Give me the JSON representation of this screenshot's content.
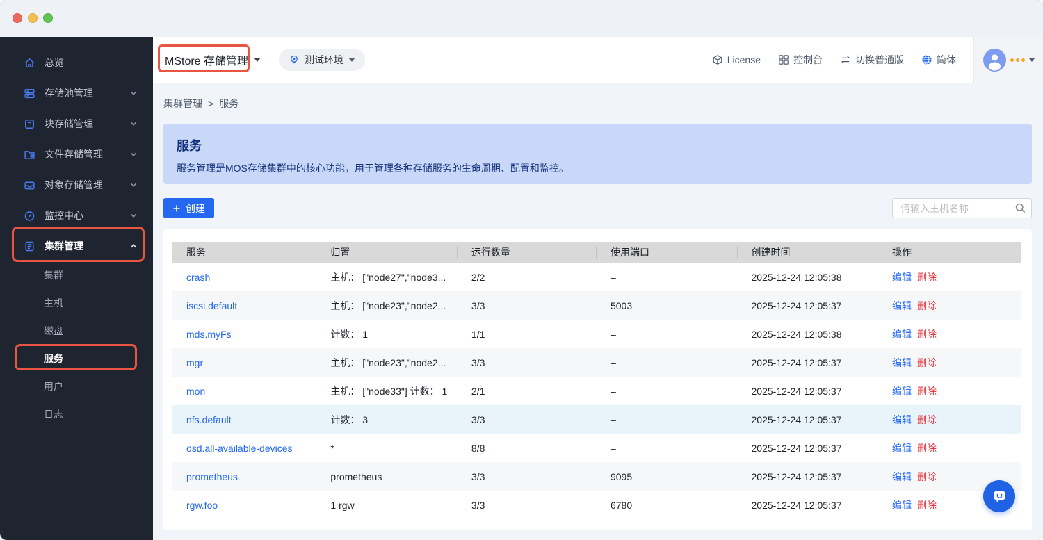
{
  "colors": {
    "accent_blue": "#2468f2",
    "annotation_red": "#e85642",
    "delete_red": "#e5353e",
    "sidebar_bg": "#1e2430",
    "banner_bg": "#c9d7f8",
    "table_header_bg": "#d9d9d9",
    "highlight_row_bg": "#e8f3fa"
  },
  "topbar": {
    "app_title": "MStore 存储管理",
    "env_label": "测试环境",
    "links": [
      {
        "label": "License",
        "icon": "license-cube-icon"
      },
      {
        "label": "控制台",
        "icon": "console-grid-icon"
      },
      {
        "label": "切换普通版",
        "icon": "switch-arrows-icon"
      },
      {
        "label": "简体",
        "icon": "globe-icon"
      }
    ]
  },
  "sidebar": {
    "items": [
      {
        "label": "总览",
        "icon": "home-icon"
      },
      {
        "label": "存储池管理",
        "icon": "storage-pool-icon",
        "chevron": "down"
      },
      {
        "label": "块存储管理",
        "icon": "block-storage-icon",
        "chevron": "down"
      },
      {
        "label": "文件存储管理",
        "icon": "file-storage-icon",
        "chevron": "down"
      },
      {
        "label": "对象存储管理",
        "icon": "object-storage-icon",
        "chevron": "down"
      },
      {
        "label": "监控中心",
        "icon": "monitor-icon",
        "chevron": "down"
      },
      {
        "label": "集群管理",
        "icon": "cluster-icon",
        "chevron": "up",
        "active": true
      }
    ],
    "cluster_children": [
      "集群",
      "主机",
      "磁盘",
      "服务",
      "用户",
      "日志"
    ],
    "active_child": "服务"
  },
  "breadcrumb": {
    "items": [
      "集群管理",
      "服务"
    ],
    "separator": ">"
  },
  "banner": {
    "title": "服务",
    "description": "服务管理是MOS存储集群中的核心功能，用于管理各种存储服务的生命周期、配置和监控。"
  },
  "toolbar": {
    "create_label": "创建",
    "search_placeholder": "请输入主机名称"
  },
  "table": {
    "columns": [
      "服务",
      "归置",
      "运行数量",
      "使用端口",
      "创建时间",
      "操作"
    ],
    "actions": {
      "edit": "编辑",
      "delete": "删除"
    },
    "rows": [
      {
        "service": "crash",
        "placement": "主机： [\"node27\",\"node3...",
        "running": "2/2",
        "ports": "–",
        "created": "2025-12-24 12:05:38"
      },
      {
        "service": "iscsi.default",
        "placement": "主机： [\"node23\",\"node2...",
        "running": "3/3",
        "ports": "5003",
        "created": "2025-12-24 12:05:37"
      },
      {
        "service": "mds.myFs",
        "placement": "计数： 1",
        "running": "1/1",
        "ports": "–",
        "created": "2025-12-24 12:05:38"
      },
      {
        "service": "mgr",
        "placement": "主机： [\"node23\",\"node2...",
        "running": "3/3",
        "ports": "–",
        "created": "2025-12-24 12:05:37"
      },
      {
        "service": "mon",
        "placement": "主机： [\"node33\"] 计数： 1",
        "running": "2/1",
        "ports": "–",
        "created": "2025-12-24 12:05:37"
      },
      {
        "service": "nfs.default",
        "placement": "计数： 3",
        "running": "3/3",
        "ports": "–",
        "created": "2025-12-24 12:05:37",
        "highlighted": true
      },
      {
        "service": "osd.all-available-devices",
        "placement": "*",
        "running": "8/8",
        "ports": "–",
        "created": "2025-12-24 12:05:37"
      },
      {
        "service": "prometheus",
        "placement": "prometheus",
        "running": "3/3",
        "ports": "9095",
        "created": "2025-12-24 12:05:37"
      },
      {
        "service": "rgw.foo",
        "placement": "1 rgw",
        "running": "3/3",
        "ports": "6780",
        "created": "2025-12-24 12:05:37"
      }
    ]
  }
}
